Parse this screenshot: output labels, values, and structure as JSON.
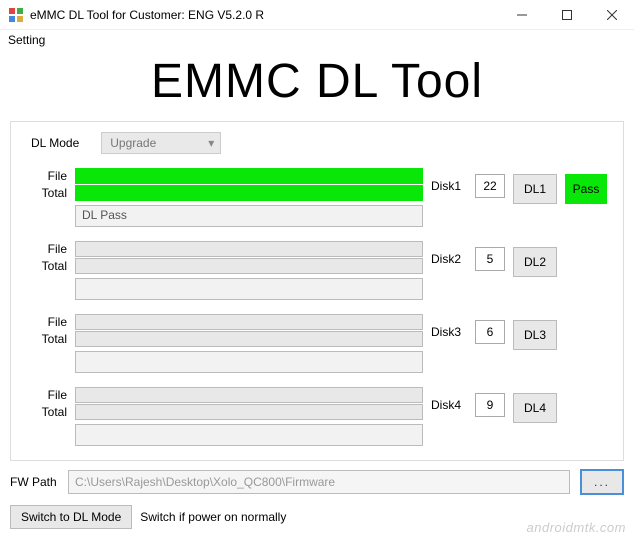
{
  "titlebar": {
    "title": "eMMC DL Tool for Customer: ENG V5.2.0 R"
  },
  "menubar": {
    "setting": "Setting"
  },
  "hero": {
    "title": "EMMC DL Tool"
  },
  "dlmode": {
    "label": "DL Mode",
    "selected": "Upgrade"
  },
  "labels": {
    "file": "File",
    "total": "Total"
  },
  "disks": [
    {
      "label": "Disk1",
      "num": "22",
      "btn": "DL1",
      "status": "DL Pass",
      "full": true,
      "pass": "Pass"
    },
    {
      "label": "Disk2",
      "num": "5",
      "btn": "DL2",
      "status": "",
      "full": false
    },
    {
      "label": "Disk3",
      "num": "6",
      "btn": "DL3",
      "status": "",
      "full": false
    },
    {
      "label": "Disk4",
      "num": "9",
      "btn": "DL4",
      "status": "",
      "full": false
    }
  ],
  "fw": {
    "label": "FW Path",
    "path": "C:\\Users\\Rajesh\\Desktop\\Xolo_QC800\\Firmware",
    "browse": "..."
  },
  "switch": {
    "btn": "Switch to DL Mode",
    "text": "Switch if power on normally"
  },
  "watermark": "androidmtk.com"
}
